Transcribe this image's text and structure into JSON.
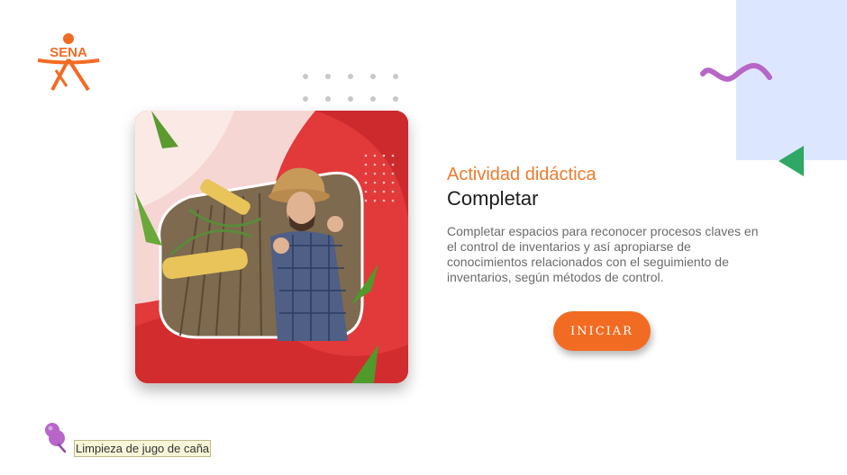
{
  "logo": {
    "text": "SENA",
    "icon": "sena-logo-icon"
  },
  "activity": {
    "label": "Actividad didáctica",
    "title": "Completar",
    "description": "Completar espacios para reconocer procesos claves en el control de inventarios y así apropiarse de conocimientos relacionados con el seguimiento de inventarios, según métodos de control."
  },
  "start_button": {
    "label": "INICIAR"
  },
  "footer": {
    "caption": "Limpieza de jugo de caña",
    "icon": "pin-icon"
  },
  "colors": {
    "accent_orange": "#ee7b2c",
    "button_orange": "#f26b22",
    "card_red": "#e2393b",
    "squiggle_purple": "#b766c8",
    "triangle_green": "#2fa866",
    "block_blue": "#dde6ff"
  }
}
